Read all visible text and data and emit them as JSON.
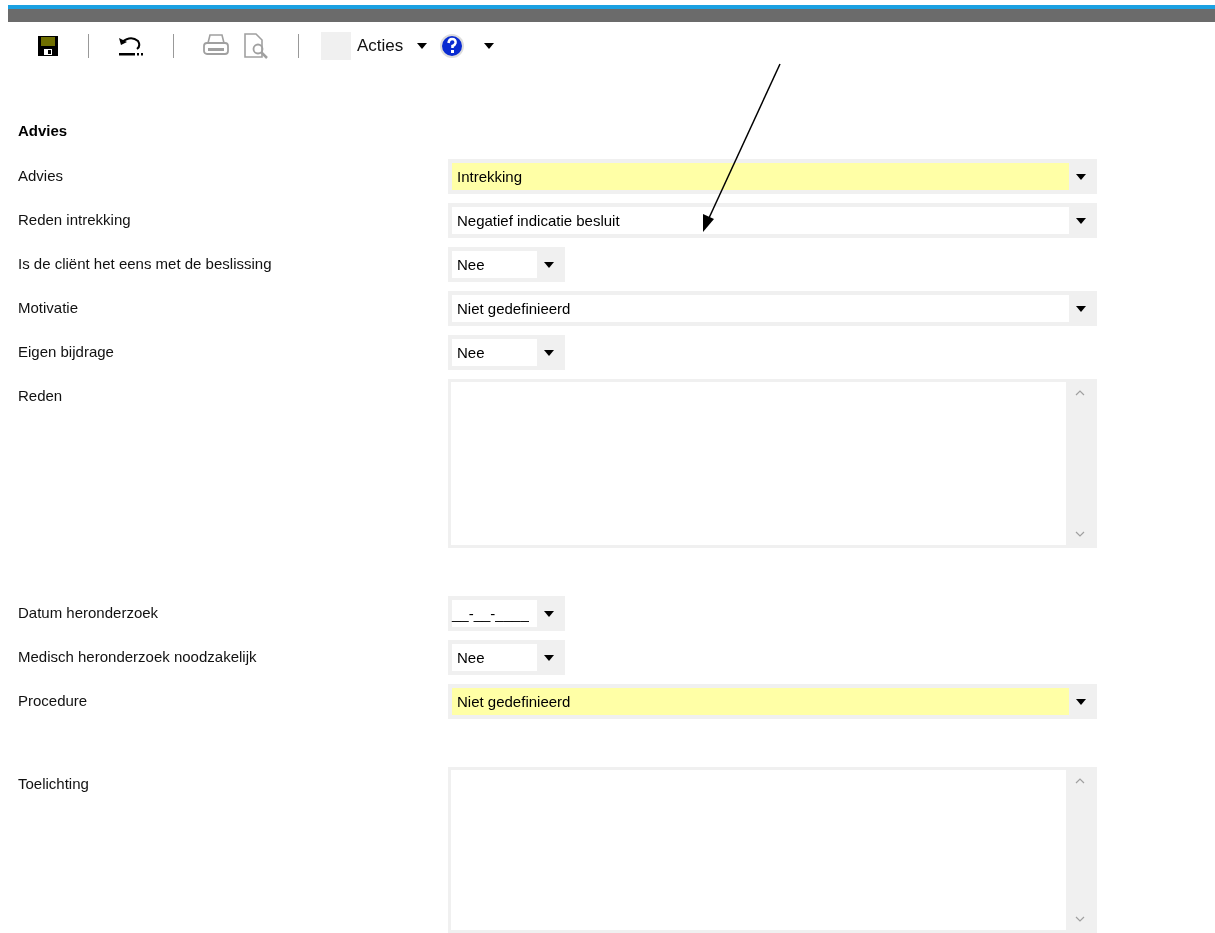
{
  "toolbar": {
    "buttons": [
      {
        "kind": "save"
      },
      {
        "kind": "separator"
      },
      {
        "kind": "undo"
      },
      {
        "kind": "separator"
      },
      {
        "kind": "print",
        "disabled": true
      },
      {
        "kind": "preview",
        "disabled": true
      },
      {
        "kind": "separator"
      },
      {
        "kind": "blank"
      },
      {
        "kind": "menu",
        "label": "Acties"
      },
      {
        "kind": "help"
      },
      {
        "kind": "caret"
      }
    ]
  },
  "section": {
    "title": "Advies"
  },
  "groups": [
    [
      {
        "label": "Advies",
        "kind": "select",
        "value": "Intrekking",
        "highlighted": true
      },
      {
        "label": "Reden intrekking",
        "kind": "select",
        "value": "Negatief indicatie besluit",
        "highlighted": false
      },
      {
        "label": "Is de cliënt het eens met de beslissing",
        "kind": "short-select",
        "value": "Nee",
        "highlighted": false
      },
      {
        "label": "Motivatie",
        "kind": "select",
        "value": "Niet gedefinieerd",
        "highlighted": false
      },
      {
        "label": "Eigen bijdrage",
        "kind": "short-select",
        "value": "Nee",
        "highlighted": false
      },
      {
        "label": "Reden",
        "kind": "textarea"
      }
    ],
    [
      {
        "label": "Datum heronderzoek",
        "kind": "date",
        "value": "__-__-____"
      },
      {
        "label": "Medisch heronderzoek noodzakelijk",
        "kind": "short-select",
        "value": "Nee",
        "highlighted": false
      },
      {
        "label": "Procedure",
        "kind": "select",
        "value": "Niet gedefinieerd",
        "highlighted": true
      }
    ],
    [
      {
        "label": "Toelichting",
        "kind": "textarea"
      }
    ]
  ]
}
